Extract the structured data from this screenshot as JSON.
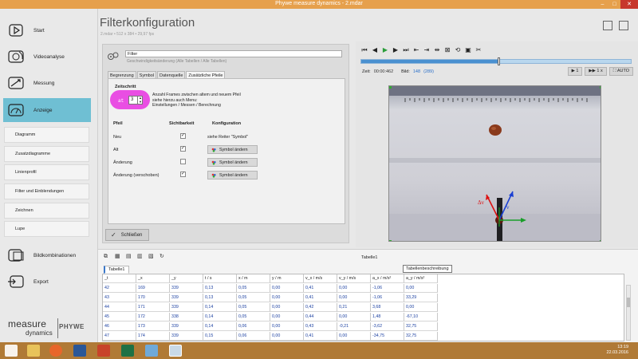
{
  "window": {
    "title": "Phywe measure dynamics - 2.mdar"
  },
  "sidebar": {
    "items": [
      {
        "label": "Start",
        "icon": "play-icon"
      },
      {
        "label": "Videoanalyse",
        "icon": "camera-icon"
      },
      {
        "label": "Messung",
        "icon": "measure-icon"
      },
      {
        "label": "Anzeige",
        "icon": "gauge-icon",
        "active": true
      }
    ],
    "subitems": [
      "Diagramm",
      "Zusatzdiagramme",
      "Linienprofil",
      "Filter und Einblendungen",
      "Zeichnen",
      "Lupe"
    ],
    "bottom_items": [
      {
        "label": "Bildkombinationen",
        "icon": "image-combine-icon"
      },
      {
        "label": "Export",
        "icon": "export-icon"
      }
    ],
    "logo": {
      "word1": "measure",
      "word2": "dynamics",
      "brand": "PHYWE"
    }
  },
  "header": {
    "title": "Filterkonfiguration",
    "subtitle": "2.mdar  •  512 x 384  •  29,97 fps"
  },
  "filter_panel": {
    "name_value": "Filter",
    "description": "Geschwindigkeitsänderung (Alle Tabellen / Alle Tabellen)",
    "tabs": [
      "Begrenzung",
      "Symbol",
      "Datenquelle",
      "Zusätzliche Pfeile"
    ],
    "zeitschritt": {
      "label": "Zeitschritt",
      "prefix": "at",
      "value": "3",
      "help_line1": "Anzahl Frames zwischen altem und neuem Pfeil",
      "help_line2": "siehe hierzu auch Menu:",
      "help_line3": "Einstellungen / Messen / Berechnung"
    },
    "columns": {
      "pfeil": "Pfeil",
      "sichtbarkeit": "Sichtbarkeit",
      "konfiguration": "Konfiguration"
    },
    "rows": [
      {
        "label": "Neu",
        "checked": true,
        "config": "siehe Reiter \"Symbol\""
      },
      {
        "label": "Alt",
        "checked": true,
        "config": "Symbol ändern"
      },
      {
        "label": "Änderung",
        "checked": false,
        "config": "Symbol ändern"
      },
      {
        "label": "Änderung (verschoben)",
        "checked": true,
        "config": "Symbol ändern"
      }
    ],
    "close_label": "Schließen"
  },
  "video": {
    "time_label": "Zeit:",
    "time_value": "00:00:462",
    "frame_label": "Bild:",
    "frame_value": "148",
    "frame_total": "(289)",
    "playhead_fraction": 0.51,
    "step_label": "1",
    "speed_label": "1 x",
    "auto_label": "AUTO"
  },
  "table": {
    "title": "Tabelle1",
    "tab_label": "Tabelle1",
    "tooltip": "Tabellenbeschreibung",
    "columns": [
      "_t",
      "_x",
      "_y",
      "t / s",
      "x / m",
      "y / m",
      "v_x / m/s",
      "v_y / m/s",
      "a_x / m/s²",
      "a_y / m/s²"
    ],
    "rows": [
      [
        "42",
        "169",
        "339",
        "0,13",
        "0,05",
        "0,00",
        "0,41",
        "0,00",
        "-1,06",
        "0,00"
      ],
      [
        "43",
        "170",
        "339",
        "0,13",
        "0,05",
        "0,00",
        "0,41",
        "0,00",
        "-1,06",
        "33,29"
      ],
      [
        "44",
        "171",
        "339",
        "0,14",
        "0,05",
        "0,00",
        "0,42",
        "0,21",
        "3,68",
        "0,00"
      ],
      [
        "45",
        "172",
        "338",
        "0,14",
        "0,05",
        "0,00",
        "0,44",
        "0,00",
        "1,48",
        "-67,10"
      ],
      [
        "46",
        "173",
        "339",
        "0,14",
        "0,06",
        "0,00",
        "0,43",
        "-0,21",
        "-3,62",
        "32,75"
      ],
      [
        "47",
        "174",
        "339",
        "0,15",
        "0,06",
        "0,00",
        "0,41",
        "0,00",
        "-34,75",
        "32,75"
      ]
    ]
  },
  "taskbar": {
    "apps": [
      "start-windows-icon",
      "explorer-icon",
      "firefox-icon",
      "word-icon",
      "powerpoint-icon",
      "excel-icon",
      "paint-icon",
      "measure-dynamics-icon"
    ],
    "clock_time": "13:19",
    "clock_date": "22.03.2016"
  }
}
